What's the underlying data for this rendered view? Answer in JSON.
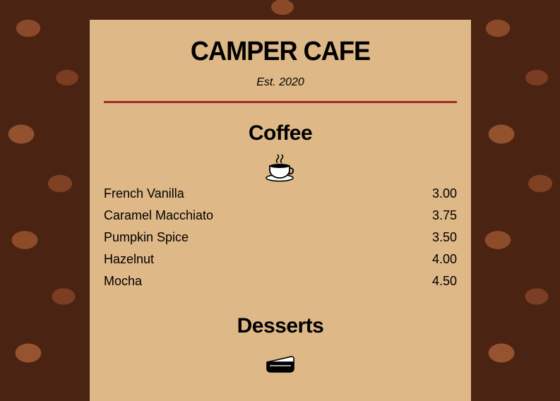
{
  "cafe": {
    "name": "CAMPER CAFE",
    "established": "Est. 2020"
  },
  "sections": [
    {
      "title": "Coffee",
      "icon": "coffee-cup-icon",
      "items": [
        {
          "name": "French Vanilla",
          "price": "3.00"
        },
        {
          "name": "Caramel Macchiato",
          "price": "3.75"
        },
        {
          "name": "Pumpkin Spice",
          "price": "3.50"
        },
        {
          "name": "Hazelnut",
          "price": "4.00"
        },
        {
          "name": "Mocha",
          "price": "4.50"
        }
      ]
    },
    {
      "title": "Desserts",
      "icon": "pie-slice-icon"
    }
  ],
  "colors": {
    "menu_background": "#deb887",
    "divider": "#a52a2a",
    "page_background": "#4a2313"
  }
}
